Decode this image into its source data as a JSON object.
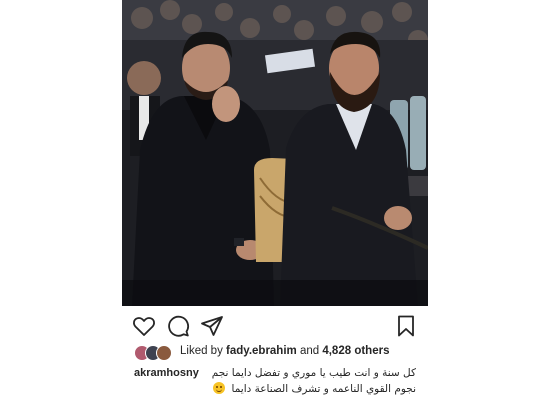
{
  "post": {
    "photo_alt": "Two men in dark suits seated at an awards ceremony with a glass trophy",
    "likes": {
      "prefix": "Liked by ",
      "user": "fady.ebrahim",
      "middle": " and ",
      "count": "4,828 others"
    },
    "caption": {
      "username": "akramhosny",
      "line1": "كل سنة و انت طيب يا موري و تفضل دايما نجم",
      "line2": "نجوم القوي الناعمه و تشرف الصناعة دايما"
    },
    "icons": [
      "heart-icon",
      "comment-icon",
      "share-icon",
      "bookmark-icon"
    ],
    "colors": {
      "text": "#262626",
      "background": "#ffffff"
    }
  }
}
